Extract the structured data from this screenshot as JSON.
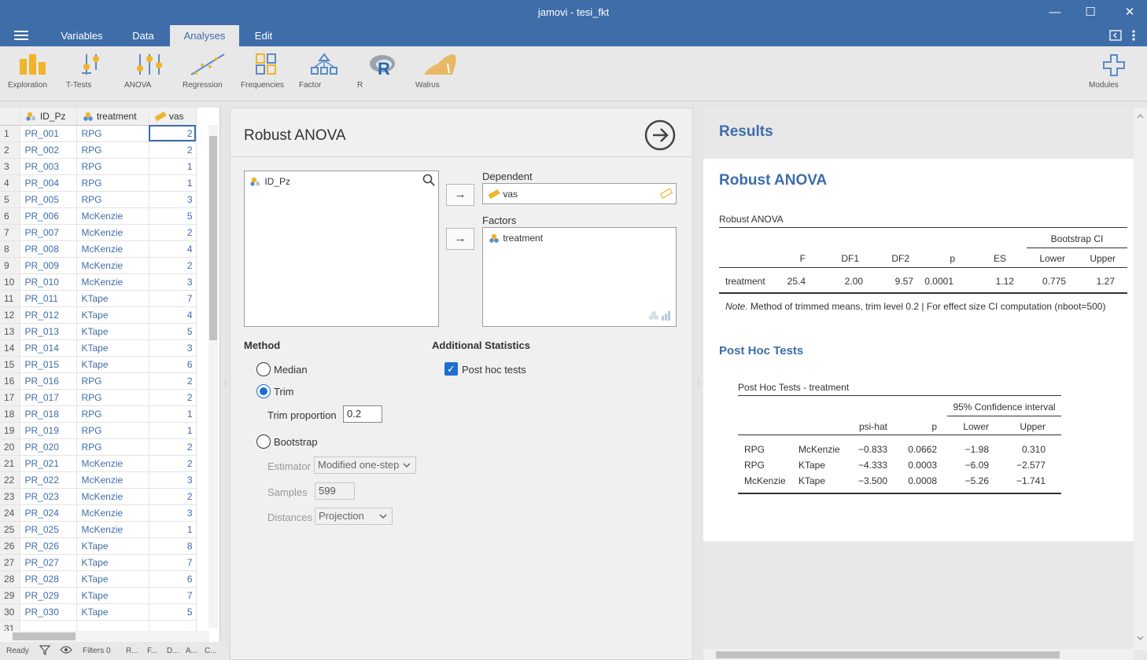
{
  "window": {
    "title": "jamovi - tesi_fkt",
    "minimize_glyph": "—",
    "maximize_glyph": "☐",
    "close_glyph": "✕"
  },
  "menu": {
    "tabs": [
      {
        "label": "Variables"
      },
      {
        "label": "Data"
      },
      {
        "label": "Analyses"
      },
      {
        "label": "Edit"
      }
    ]
  },
  "ribbon": {
    "items": [
      {
        "label": "Exploration",
        "icon": "bar-chart-icon"
      },
      {
        "label": "T-Tests",
        "icon": "t-tests-icon"
      },
      {
        "label": "ANOVA",
        "icon": "anova-icon"
      },
      {
        "label": "Regression",
        "icon": "regression-icon"
      },
      {
        "label": "Frequencies",
        "icon": "frequencies-icon"
      },
      {
        "label": "Factor",
        "icon": "factor-icon"
      },
      {
        "label": "R",
        "icon": "r-icon"
      },
      {
        "label": "Walrus",
        "icon": "walrus-icon"
      },
      {
        "label": "Modules",
        "icon": "plus-icon"
      }
    ]
  },
  "sheet": {
    "columns": [
      "ID_Pz",
      "treatment",
      "vas"
    ],
    "rows": [
      [
        "1",
        "PR_001",
        "RPG",
        "2"
      ],
      [
        "2",
        "PR_002",
        "RPG",
        "2"
      ],
      [
        "3",
        "PR_003",
        "RPG",
        "1"
      ],
      [
        "4",
        "PR_004",
        "RPG",
        "1"
      ],
      [
        "5",
        "PR_005",
        "RPG",
        "3"
      ],
      [
        "6",
        "PR_006",
        "McKenzie",
        "5"
      ],
      [
        "7",
        "PR_007",
        "McKenzie",
        "2"
      ],
      [
        "8",
        "PR_008",
        "McKenzie",
        "4"
      ],
      [
        "9",
        "PR_009",
        "McKenzie",
        "2"
      ],
      [
        "10",
        "PR_010",
        "McKenzie",
        "3"
      ],
      [
        "11",
        "PR_011",
        "KTape",
        "7"
      ],
      [
        "12",
        "PR_012",
        "KTape",
        "4"
      ],
      [
        "13",
        "PR_013",
        "KTape",
        "5"
      ],
      [
        "14",
        "PR_014",
        "KTape",
        "3"
      ],
      [
        "15",
        "PR_015",
        "KTape",
        "6"
      ],
      [
        "16",
        "PR_016",
        "RPG",
        "2"
      ],
      [
        "17",
        "PR_017",
        "RPG",
        "2"
      ],
      [
        "18",
        "PR_018",
        "RPG",
        "1"
      ],
      [
        "19",
        "PR_019",
        "RPG",
        "1"
      ],
      [
        "20",
        "PR_020",
        "RPG",
        "2"
      ],
      [
        "21",
        "PR_021",
        "McKenzie",
        "2"
      ],
      [
        "22",
        "PR_022",
        "McKenzie",
        "3"
      ],
      [
        "23",
        "PR_023",
        "McKenzie",
        "2"
      ],
      [
        "24",
        "PR_024",
        "McKenzie",
        "3"
      ],
      [
        "25",
        "PR_025",
        "McKenzie",
        "1"
      ],
      [
        "26",
        "PR_026",
        "KTape",
        "8"
      ],
      [
        "27",
        "PR_027",
        "KTape",
        "7"
      ],
      [
        "28",
        "PR_028",
        "KTape",
        "6"
      ],
      [
        "29",
        "PR_029",
        "KTape",
        "7"
      ],
      [
        "30",
        "PR_030",
        "KTape",
        "5"
      ]
    ],
    "partial_row_num": "31"
  },
  "status": {
    "ready": "Ready",
    "filters": "Filters 0",
    "r": "R...",
    "f": "F...",
    "d": "D...",
    "a": "A...",
    "c": "C..."
  },
  "options": {
    "title": "Robust ANOVA",
    "source_vars": [
      "ID_Pz"
    ],
    "dependent_label": "Dependent",
    "dependent_var": "vas",
    "factors_label": "Factors",
    "factors_vars": [
      "treatment"
    ],
    "arrow_glyph": "→",
    "method": {
      "title": "Method",
      "median": "Median",
      "trim": "Trim",
      "trim_proportion_label": "Trim proportion",
      "trim_proportion_value": "0.2",
      "bootstrap": "Bootstrap",
      "estimator_label": "Estimator",
      "estimator_value": "Modified one-step",
      "samples_label": "Samples",
      "samples_value": "599",
      "distances_label": "Distances",
      "distances_value": "Projection",
      "selected": "Trim"
    },
    "additional": {
      "title": "Additional Statistics",
      "posthoc_label": "Post hoc tests",
      "posthoc_checked": true
    }
  },
  "results": {
    "header": "Results",
    "anova": {
      "title": "Robust ANOVA",
      "caption": "Robust ANOVA",
      "bootstrap_header": "Bootstrap CI",
      "columns": [
        "F",
        "DF1",
        "DF2",
        "p",
        "ES",
        "Lower",
        "Upper"
      ],
      "row_label": "treatment",
      "row": [
        "25.4",
        "2.00",
        "9.57",
        "0.0001",
        "1.12",
        "0.775",
        "1.27"
      ],
      "note_prefix": "Note.",
      "note_text": " Method of trimmed means, trim level 0.2 | For effect size CI computation (nboot=500)"
    },
    "posthoc": {
      "title": "Post Hoc Tests",
      "caption": "Post Hoc Tests - treatment",
      "ci_header": "95% Confidence interval",
      "columns": [
        "psi-hat",
        "p",
        "Lower",
        "Upper"
      ],
      "rows": [
        [
          "RPG",
          "McKenzie",
          "−0.833",
          "0.0662",
          "−1.98",
          "0.310"
        ],
        [
          "RPG",
          "KTape",
          "−4.333",
          "0.0003",
          "−6.09",
          "−2.577"
        ],
        [
          "McKenzie",
          "KTape",
          "−3.500",
          "0.0008",
          "−5.26",
          "−1.741"
        ]
      ]
    }
  }
}
